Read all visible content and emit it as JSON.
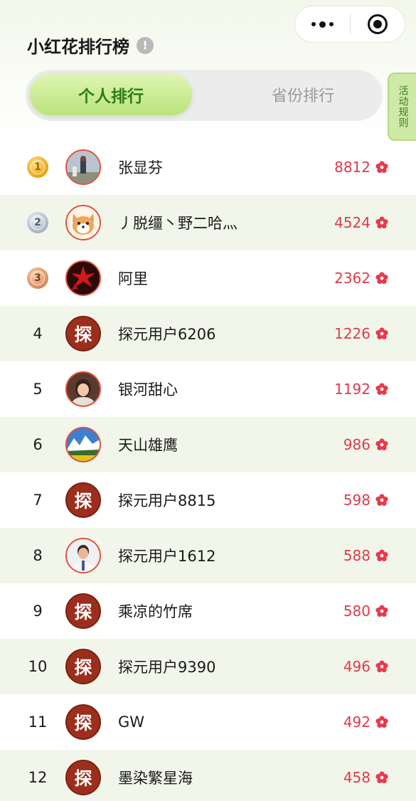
{
  "header": {
    "title": "小红花排行榜",
    "info_icon": "!",
    "menu_icon": "more-dots-icon",
    "close_icon": "target-close-icon"
  },
  "tabs": {
    "active": "个人排行",
    "inactive": "省份排行"
  },
  "rules_tab": "活动规则",
  "colors": {
    "accent_green": "#2f7d18",
    "score_red": "#e03a4a",
    "row_alt_bg": "#f2f6ea"
  },
  "ranking": [
    {
      "rank": "1",
      "name": "张显芬",
      "score": "8812"
    },
    {
      "rank": "2",
      "name": "丿脱缰丶野二哈灬",
      "score": "4524"
    },
    {
      "rank": "3",
      "name": "阿里",
      "score": "2362"
    },
    {
      "rank": "4",
      "name": "探元用户6206",
      "score": "1226",
      "avatar_text": "探"
    },
    {
      "rank": "5",
      "name": "银河甜心",
      "score": "1192"
    },
    {
      "rank": "6",
      "name": "天山雄鹰",
      "score": "986"
    },
    {
      "rank": "7",
      "name": "探元用户8815",
      "score": "598",
      "avatar_text": "探"
    },
    {
      "rank": "8",
      "name": "探元用户1612",
      "score": "588"
    },
    {
      "rank": "9",
      "name": "乘凉的竹席",
      "score": "580",
      "avatar_text": "探"
    },
    {
      "rank": "10",
      "name": "探元用户9390",
      "score": "496",
      "avatar_text": "探"
    },
    {
      "rank": "11",
      "name": "GW",
      "score": "492",
      "avatar_text": "探"
    },
    {
      "rank": "12",
      "name": "墨染繁星海",
      "score": "458",
      "avatar_text": "探"
    }
  ]
}
